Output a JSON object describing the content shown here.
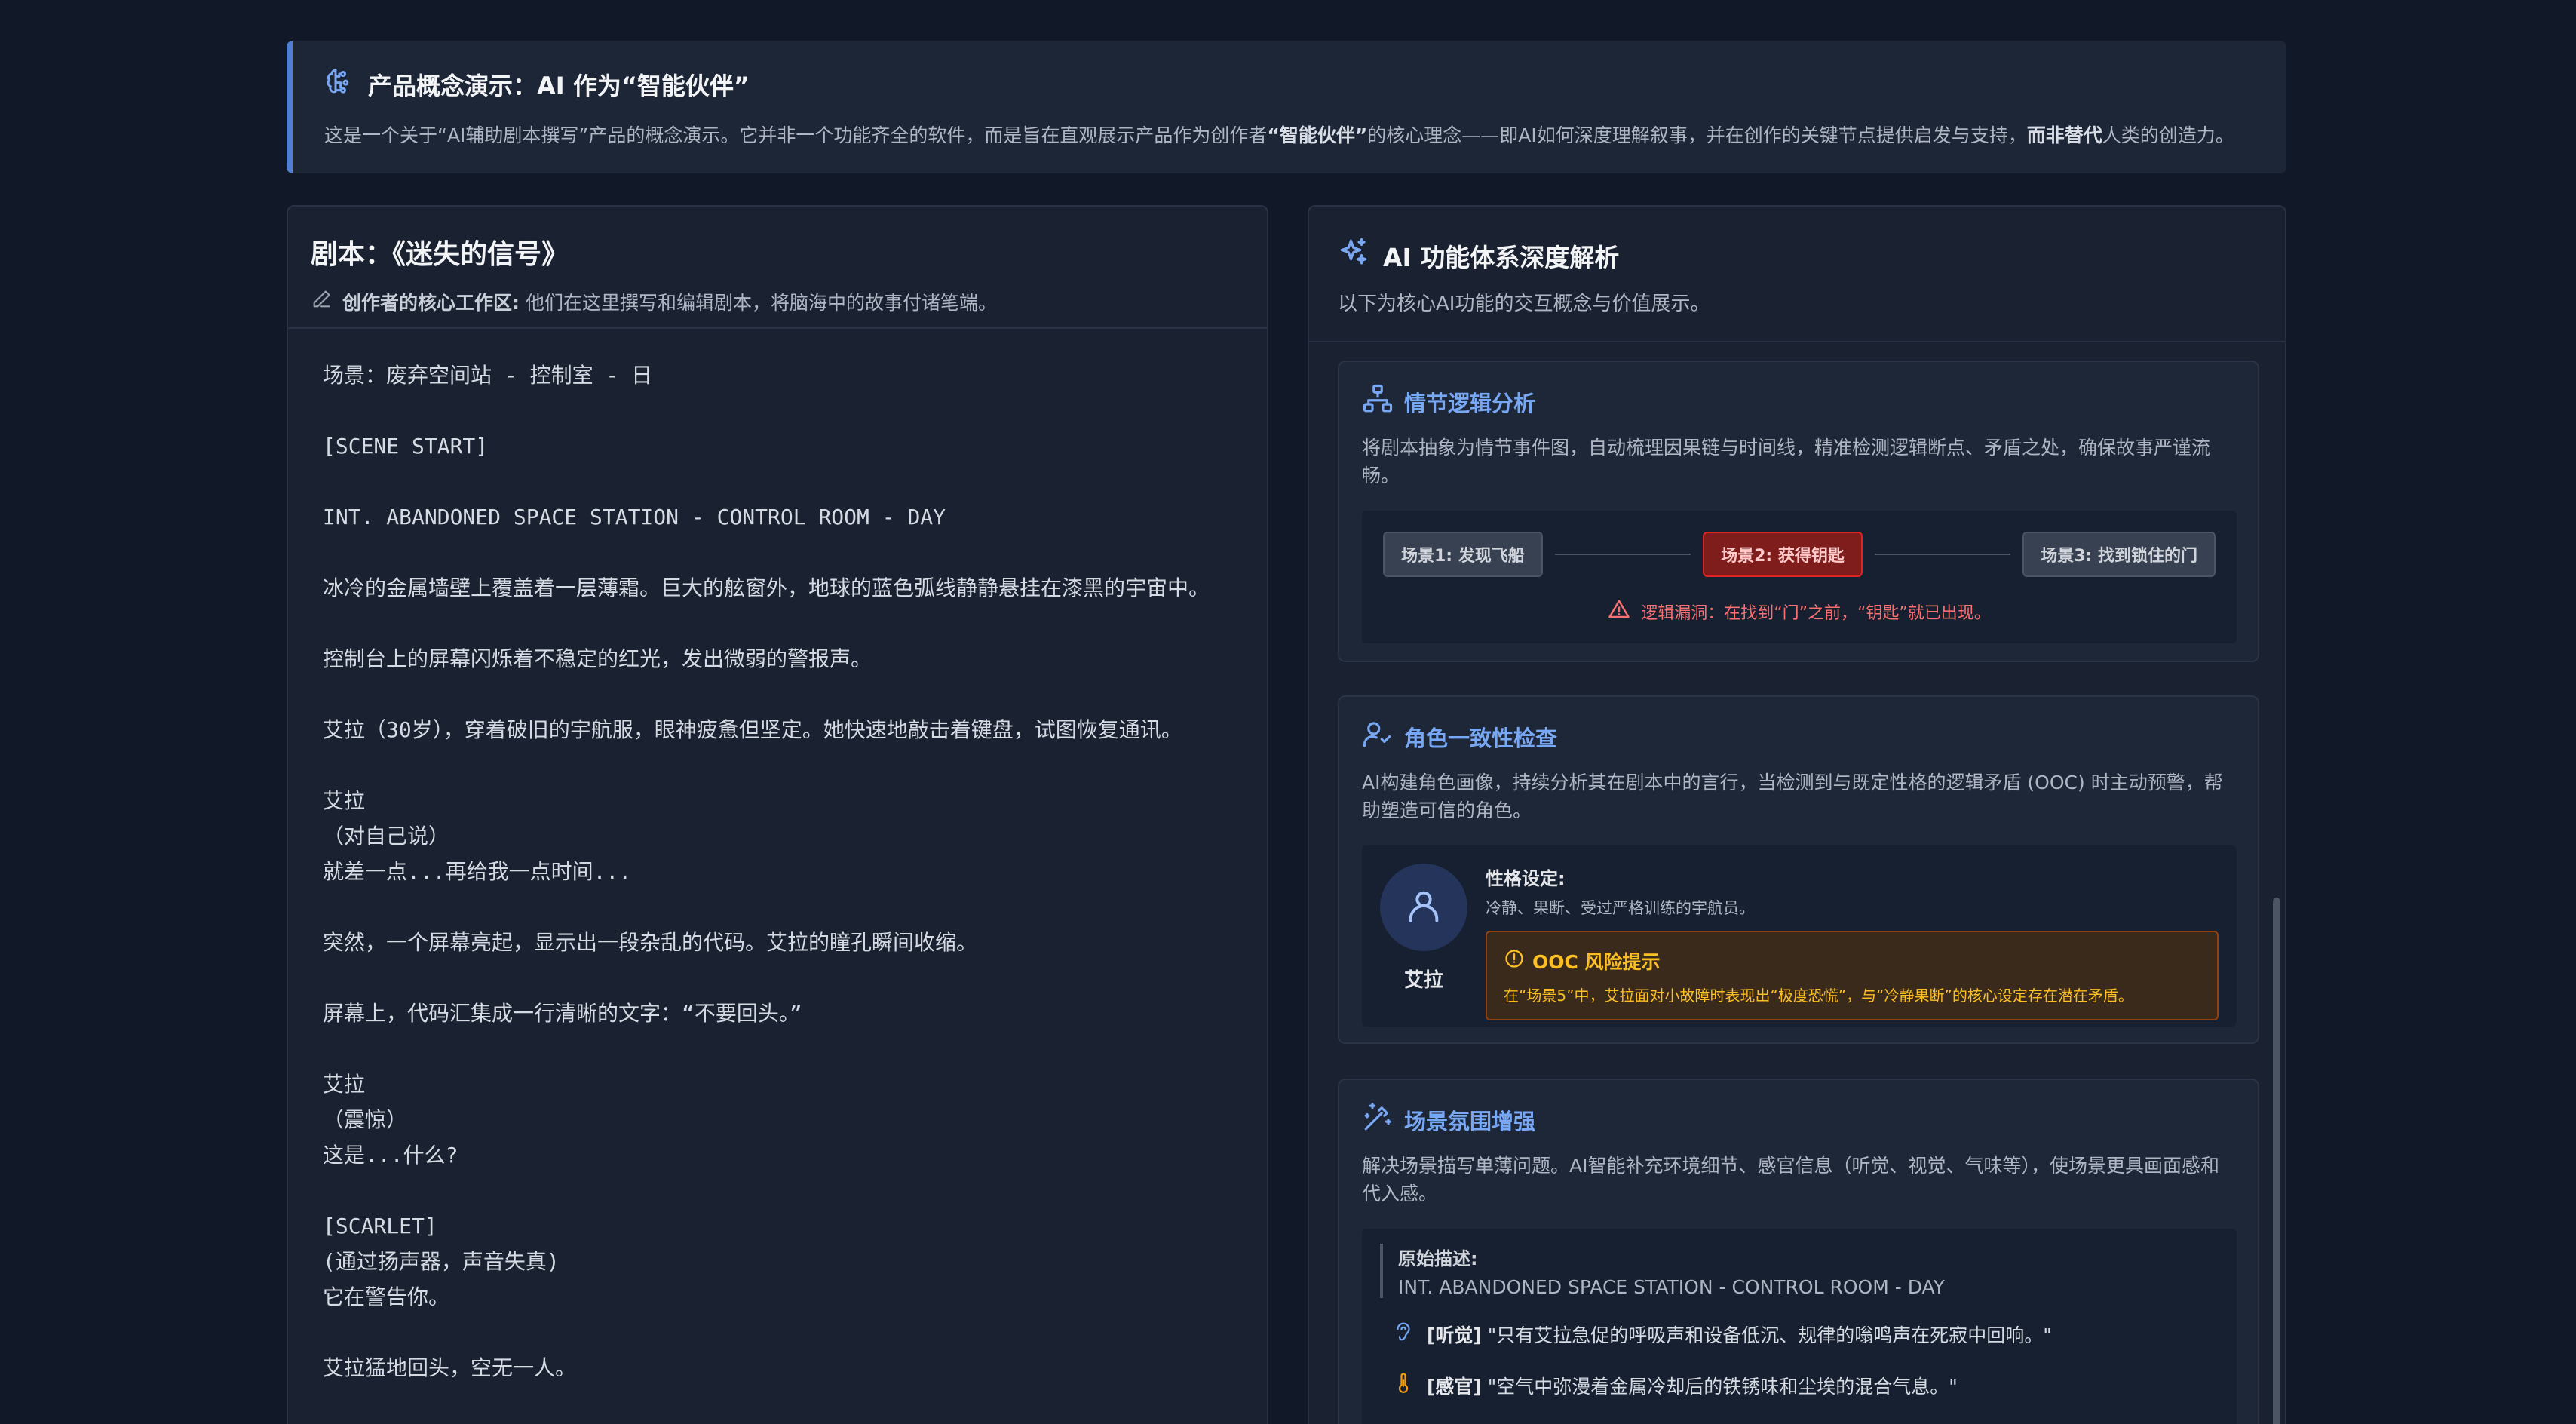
{
  "banner": {
    "title": "产品概念演示：AI 作为“智能伙伴”",
    "desc_1": "这是一个关于“AI辅助剧本撰写”产品的概念演示。它并非一个功能齐全的软件，而是旨在直观展示产品作为创作者",
    "desc_bold_1": "“智能伙伴”",
    "desc_2": "的核心理念——即AI如何深度理解叙事，并在创作的关键节点提供启发与支持，",
    "desc_bold_2": "而非替代",
    "desc_3": "人类的创造力。"
  },
  "script": {
    "title": "剧本：《迷失的信号》",
    "sub_bold": "创作者的核心工作区:",
    "sub_text": " 他们在这里撰写和编辑剧本，将脑海中的故事付诸笔端。",
    "lines": [
      "场景：废弃空间站 - 控制室 - 日",
      "",
      "[SCENE START]",
      "",
      "INT. ABANDONED SPACE STATION - CONTROL ROOM - DAY",
      "",
      "冰冷的金属墙壁上覆盖着一层薄霜。巨大的舷窗外，地球的蓝色弧线静静悬挂在漆黑的宇宙中。",
      "",
      "控制台上的屏幕闪烁着不稳定的红光，发出微弱的警报声。",
      "",
      "艾拉（30岁），穿着破旧的宇航服，眼神疲惫但坚定。她快速地敲击着键盘，试图恢复通讯。",
      "",
      "艾拉",
      "（对自己说）",
      "就差一点...再给我一点时间...",
      "",
      "突然，一个屏幕亮起，显示出一段杂乱的代码。艾拉的瞳孔瞬间收缩。",
      "",
      "屏幕上，代码汇集成一行清晰的文字：“不要回头。”",
      "",
      "艾拉",
      "（震惊）",
      "这是...什么?",
      "",
      "[SCARLET]",
      "(通过扬声器，声音失真)",
      "它在警告你。",
      "",
      "艾拉猛地回头，空无一人。"
    ]
  },
  "ai": {
    "title": "AI 功能体系深度解析",
    "subtitle": "以下为核心AI功能的交互概念与价值展示。",
    "plot": {
      "title": "情节逻辑分析",
      "desc": "将剧本抽象为情节事件图，自动梳理因果链与时间线，精准检测逻辑断点、矛盾之处，确保故事严谨流畅。",
      "nodes": [
        "场景1: 发现飞船",
        "场景2: 获得钥匙",
        "场景3: 找到锁住的门"
      ],
      "warning": "逻辑漏洞：在找到“门”之前，“钥匙”就已出现。"
    },
    "character": {
      "title": "角色一致性检查",
      "desc": "AI构建角色画像，持续分析其在剧本中的言行，当检测到与既定性格的逻辑矛盾 (OOC) 时主动预警，帮助塑造可信的角色。",
      "name": "艾拉",
      "trait_label": "性格设定:",
      "trait_text": "冷静、果断、受过严格训练的宇航员。",
      "ooc_title": "OOC 风险提示",
      "ooc_text": "在“场景5”中，艾拉面对小故障时表现出“极度恐慌”，与“冷静果断”的核心设定存在潜在矛盾。"
    },
    "atmosphere": {
      "title": "场景氛围增强",
      "desc": "解决场景描写单薄问题。AI智能补充环境细节、感官信息（听觉、视觉、气味等），使场景更具画面感和代入感。",
      "orig_label": "原始描述:",
      "orig_text": "INT. ABANDONED SPACE STATION - CONTROL ROOM - DAY",
      "hearing_label": "[听觉]",
      "hearing_text": " \"只有艾拉急促的呼吸声和设备低沉、规律的嗡鸣声在死寂中回响。\"",
      "sense_label": "[感官]",
      "sense_text": " \"空气中弥漫着金属冷却后的铁锈味和尘埃的混合气息。\""
    }
  },
  "colors": {
    "accent": "#78a7f4",
    "error": "#dc2626",
    "warning": "#fbbf24",
    "background": "#111827"
  },
  "icons": [
    "brain-icon",
    "pencil-icon",
    "sparkles-icon",
    "network-icon",
    "alert-triangle-icon",
    "user-check-icon",
    "user-icon",
    "alert-circle-icon",
    "magic-wand-icon",
    "ear-icon",
    "thermometer-icon"
  ]
}
